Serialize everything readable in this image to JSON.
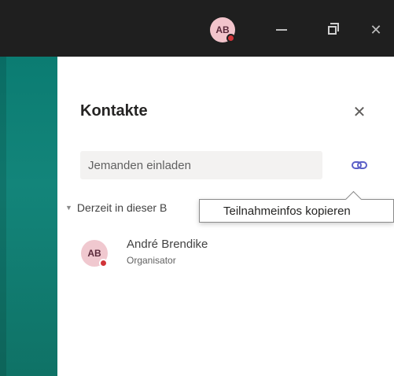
{
  "titlebar": {
    "avatar_initials": "AB",
    "presence_color": "#d13438"
  },
  "panel": {
    "title": "Kontakte",
    "invite_placeholder": "Jemanden einladen",
    "section_label": "Derzeit in dieser B",
    "tooltip": "Teilnahmeinfos kopieren",
    "participants": [
      {
        "initials": "AB",
        "name": "André Brendike",
        "role": "Organisator"
      }
    ]
  },
  "colors": {
    "titlebar_bg": "#1f1f1f",
    "accent_teal": "#0b7c72",
    "link_icon": "#5b5fc7"
  }
}
